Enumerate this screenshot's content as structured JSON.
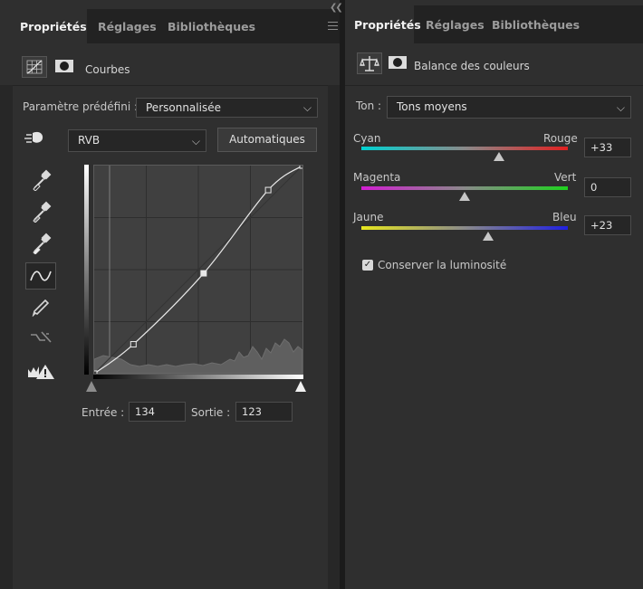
{
  "left_panel": {
    "tabs": [
      {
        "label": "Propriétés",
        "active": true
      },
      {
        "label": "Réglages",
        "active": false
      },
      {
        "label": "Bibliothèques",
        "active": false
      }
    ],
    "header": {
      "title": "Courbes",
      "icon": "curves-adjustment-icon",
      "mask_icon": "layer-mask-icon"
    },
    "preset": {
      "label": "Paramètre prédéfini :",
      "value": "Personnalisée"
    },
    "channel": {
      "value": "RVB"
    },
    "auto_button": "Automatiques",
    "tools": [
      "target-adjust-icon",
      "eyedropper-black-icon",
      "eyedropper-gray-icon",
      "eyedropper-white-icon",
      "curve-point-icon",
      "pencil-icon",
      "smooth-curve-icon",
      "clipping-warning-icon"
    ],
    "curve": {
      "points": [
        [
          0,
          0
        ],
        [
          48,
          36
        ],
        [
          134,
          123
        ],
        [
          213,
          225
        ],
        [
          255,
          255
        ]
      ]
    },
    "input": {
      "label": "Entrée :",
      "value": "134"
    },
    "output": {
      "label": "Sortie :",
      "value": "123"
    }
  },
  "right_panel": {
    "tabs": [
      {
        "label": "Propriétés",
        "active": true
      },
      {
        "label": "Réglages",
        "active": false
      },
      {
        "label": "Bibliothèques",
        "active": false
      }
    ],
    "header": {
      "title": "Balance des couleurs",
      "icon": "color-balance-icon",
      "mask_icon": "layer-mask-icon"
    },
    "tone": {
      "label": "Ton :",
      "value": "Tons moyens"
    },
    "sliders": [
      {
        "left_label": "Cyan",
        "right_label": "Rouge",
        "value": "+33",
        "level": 33,
        "left_color": "#00d2d2",
        "right_color": "#e12020"
      },
      {
        "left_label": "Magenta",
        "right_label": "Vert",
        "value": "0",
        "level": 0,
        "left_color": "#d21ed2",
        "right_color": "#1ed21e"
      },
      {
        "left_label": "Jaune",
        "right_label": "Bleu",
        "value": "+23",
        "level": 23,
        "left_color": "#e6e61e",
        "right_color": "#2020e1"
      }
    ],
    "preserve_luminosity": {
      "label": "Conserver la luminosité",
      "checked": true
    }
  }
}
